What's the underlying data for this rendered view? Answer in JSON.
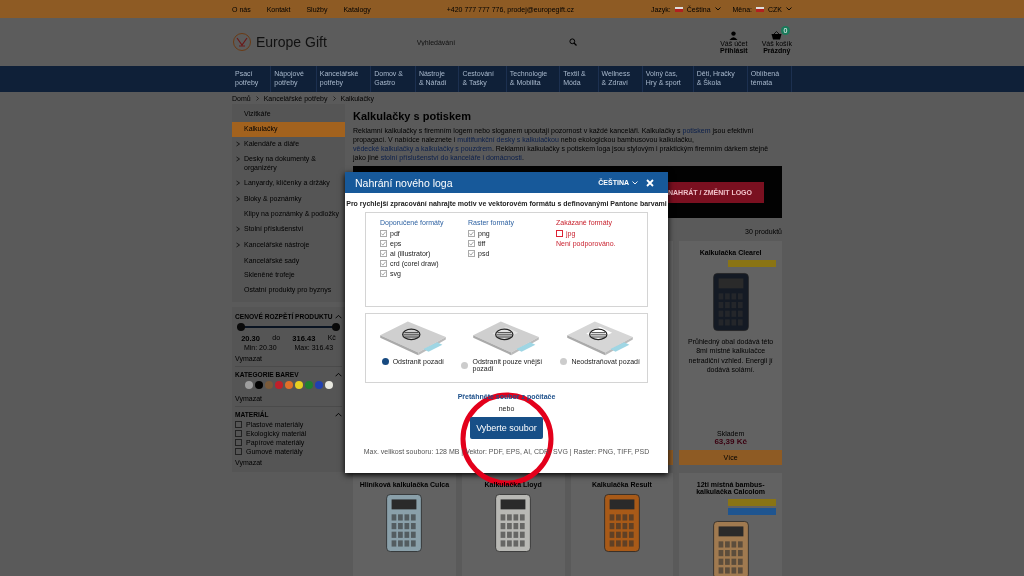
{
  "top_bar": {
    "links": [
      "O nás",
      "Kontakt",
      "Služby",
      "Katalogy"
    ],
    "contact": "+420 777 777 776, prodej@europegift.cz",
    "language_label": "Jazyk:",
    "language": "Čeština",
    "currency_label": "Měna:",
    "currency": "CZK"
  },
  "header": {
    "logo": "Europe Gift",
    "search": {
      "placeholder": "Vyhledávání"
    },
    "account": {
      "label": "Váš účet",
      "action": "Přihlásit"
    },
    "cart": {
      "label": "Váš košík",
      "status": "Prázdný",
      "count": "0"
    }
  },
  "nav": [
    {
      "label": "Psací\npotřeby"
    },
    {
      "label": "Nápojové\npotřeby"
    },
    {
      "label": "Kancelářské\npotřeby"
    },
    {
      "label": "Domov &\nGastro"
    },
    {
      "label": "Nástroje\n& Nářadí"
    },
    {
      "label": "Cestování\n& Tašky"
    },
    {
      "label": "Technologie\n& Mobilita"
    },
    {
      "label": "Textil &\nMóda"
    },
    {
      "label": "Wellness\n& Zdraví"
    },
    {
      "label": "Volný čas,\nHry & sport"
    },
    {
      "label": "Děti, Hračky\n& Škola"
    },
    {
      "label": "Oblíbená\ntémata"
    }
  ],
  "breadcrumb": [
    "Domů",
    "Kancelářské potřeby",
    "Kalkulačky"
  ],
  "categories": [
    {
      "label": "Vizitkáře",
      "expandable": false,
      "selected": false
    },
    {
      "label": "Kalkulačky",
      "expandable": false,
      "selected": true
    },
    {
      "label": "Kalendáře a diáře",
      "expandable": true,
      "selected": false
    },
    {
      "label": "Desky na dokumenty & organizéry",
      "expandable": true,
      "selected": false
    },
    {
      "label": "Lanyardy, klíčenky a držáky",
      "expandable": true,
      "selected": false
    },
    {
      "label": "Bloky & poznámky",
      "expandable": true,
      "selected": false
    },
    {
      "label": "Klipy na poznámky & podložky",
      "expandable": false,
      "selected": false
    },
    {
      "label": "Stolní příslušenství",
      "expandable": true,
      "selected": false
    },
    {
      "label": "Kancelářské nástroje",
      "expandable": true,
      "selected": false
    },
    {
      "label": "Kancelářské sady",
      "expandable": false,
      "selected": false
    },
    {
      "label": "Skleněné trofeje",
      "expandable": false,
      "selected": false
    },
    {
      "label": "Ostatní produkty pro byznys",
      "expandable": false,
      "selected": false
    }
  ],
  "filters": {
    "price": {
      "title": "CENOVÉ ROZPĚTÍ PRODUKTU",
      "expanded": true,
      "thumbs": [
        {
          "level": 0
        },
        {
          "level": 1
        }
      ],
      "from": "20.30",
      "to_label": "do",
      "to": "316.43",
      "currency": "Kč",
      "min": "Min: 20.30",
      "max": "Max: 316.43",
      "clear": "Vymazat"
    },
    "colors": {
      "title": "KATEGORIE BAREV",
      "expanded": true,
      "swatches": [
        {
          "color": "#9e9e9e"
        },
        {
          "color": "#000000"
        },
        {
          "color": "#7a5a3a"
        },
        {
          "color": "#c0202a"
        },
        {
          "color": "#e0702a"
        },
        {
          "color": "#e8d020"
        },
        {
          "color": "#208030"
        },
        {
          "color": "#2040b0"
        },
        {
          "color": "#e8e8e0"
        }
      ],
      "clear": "Vymazat"
    },
    "material": {
      "title": "MATERIÁL",
      "expanded": true,
      "options": [
        {
          "label": "Plastové materiály",
          "checked": false
        },
        {
          "label": "Ekologický materiál",
          "checked": false
        },
        {
          "label": "Papírové materiály",
          "checked": false
        },
        {
          "label": "Gumové materiály",
          "checked": false
        }
      ],
      "clear": "Vymazat"
    }
  },
  "main": {
    "title": "Kalkulačky s potiskem",
    "intro": [
      {
        "text": "Reklamní kalkulačky s firemním logem nebo sloganem upoutají pozornost v každé kanceláři. Kalkulačky s ",
        "kind": "text"
      },
      {
        "text": "potiskem",
        "kind": "link"
      },
      {
        "text": " jsou efektivní propagací. V nabídce naleznete i ",
        "kind": "text"
      },
      {
        "text": "multifunkční desky s kalkulačkou",
        "kind": "link"
      },
      {
        "text": " nebo ekologickou bambusovou kalkulačku, ",
        "kind": "text"
      },
      {
        "text": "vědecké kalkulačky a kalkulačky s pouzdrem",
        "kind": "link"
      },
      {
        "text": ". Reklamní kalkulačky s potiskem loga jsou stylovým i praktickým firemním dárkem stejně jako jiné ",
        "kind": "text"
      },
      {
        "text": "stolní příslušenství do kanceláře i domácnosti",
        "kind": "link"
      },
      {
        "text": ".",
        "kind": "text"
      }
    ],
    "banner_button": "NAHRÁT / ZMĚNIT LOGO",
    "count": "30 produktů",
    "products": [
      {
        "title": "Kalkulačka Clearel",
        "badges": [
          {
            "color": "#8a7414"
          }
        ],
        "kind": "dark",
        "description": "Průhledný obal dodává této 8mi místné kalkulačce netradiční vzhled. Energii jí dodává solární.",
        "stock": "Skladem",
        "price": "63,39 Kč",
        "button": "Více"
      },
      {
        "title": "Hliníková kalkulačka Culca",
        "kind": "silver"
      },
      {
        "title": "Kalkulačka Lloyd",
        "kind": "white"
      },
      {
        "title": "Kalkulačka Result",
        "kind": "orange"
      },
      {
        "title": "12ti místná bambus-kalkulačka Calcolom",
        "badges": [
          {
            "color": "#8a7414"
          },
          {
            "color": "#1f5590"
          }
        ],
        "kind": "bamboo"
      }
    ]
  },
  "dialog": {
    "title": "Nahrání nového loga",
    "language": "ČEŠTINA",
    "intro": "Pro rychlejší zpracování nahrajte motiv ve vektorovém formátu s definovanými Pantone barvami",
    "format_groups": [
      {
        "title": "Doporučené formáty",
        "kind": "allowed",
        "items": [
          {
            "label": "pdf",
            "checked": true
          },
          {
            "label": "eps",
            "checked": true
          },
          {
            "label": "ai (illustrator)",
            "checked": true
          },
          {
            "label": "crd (corel draw)",
            "checked": true
          },
          {
            "label": "svg",
            "checked": true
          }
        ]
      },
      {
        "title": "Raster formáty",
        "kind": "allowed",
        "items": [
          {
            "label": "png",
            "checked": true
          },
          {
            "label": "tiff",
            "checked": true
          },
          {
            "label": "psd",
            "checked": true
          }
        ]
      },
      {
        "title": "Zakázané formáty",
        "kind": "forbidden",
        "items": [
          {
            "label": "jpg",
            "checked": false
          }
        ],
        "note": "Není podporováno."
      }
    ],
    "background_options": [
      {
        "label": "Odstranit pozadí",
        "selected": true
      },
      {
        "label": "Odstranit pouze vnější pozadí",
        "selected": false
      },
      {
        "label": "Neodstraňovat pozadí",
        "selected": false
      }
    ],
    "drop_hint": "Přetáhněte soubor z počítače",
    "or": "nebo",
    "button": "Vyberte soubor",
    "limits": "Max. velikost souboru: 128 MB | Vektor: PDF, EPS, AI, CDR, SVG | Raster: PNG, TIFF, PSD"
  }
}
